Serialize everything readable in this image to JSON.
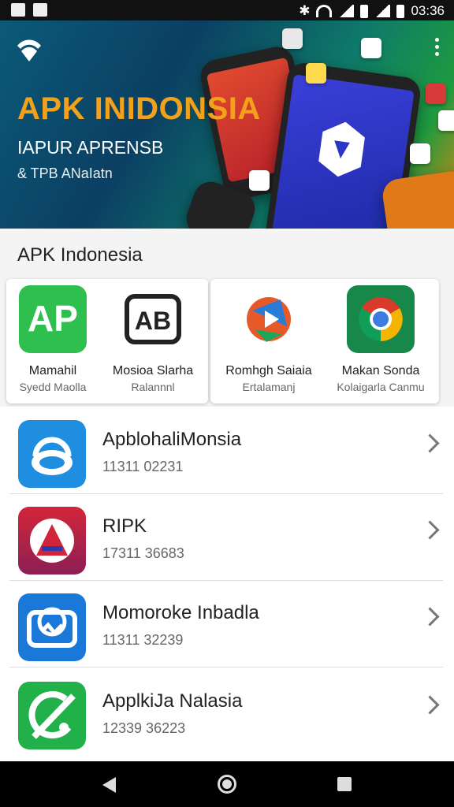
{
  "status_bar": {
    "time": "03:36"
  },
  "hero": {
    "title": "APK INIDONSIA",
    "subtitle": "IAPUR APRENSB",
    "tagline": "& TPB ANaIatn"
  },
  "section_title": "APK Indonesia",
  "featured": [
    {
      "name": "Mamahil",
      "sub": "Syedd Maolla",
      "icon": "ap-letters-icon",
      "color": "#2fbf4f"
    },
    {
      "name": "Mosioa Slarha",
      "sub": "Ralannnl",
      "icon": "ab-badge-icon",
      "color": "#ffffff"
    },
    {
      "name": "Romhgh Saiaia",
      "sub": "Ertalamanj",
      "icon": "colorful-play-icon",
      "color": "#ffffff"
    },
    {
      "name": "Makan Sonda",
      "sub": "Kolaigarla Canmu",
      "icon": "chrome-like-icon",
      "color": "#18884a"
    }
  ],
  "apps": [
    {
      "title": "ApblohaliMonsia",
      "meta": "11311 02231",
      "icon": "cloud-headset-icon",
      "color": "#1f8ee0"
    },
    {
      "title": "RIPK",
      "meta": "17311 36683",
      "icon": "triangle-a-icon",
      "color": "#d3253a"
    },
    {
      "title": "Momoroke Inbadla",
      "meta": "11311 32239",
      "icon": "globe-box-icon",
      "color": "#1a78d8"
    },
    {
      "title": "ApplkiJa Nalasia",
      "meta": "12339 36223",
      "icon": "slash-circle-icon",
      "color": "#21b04a"
    }
  ]
}
